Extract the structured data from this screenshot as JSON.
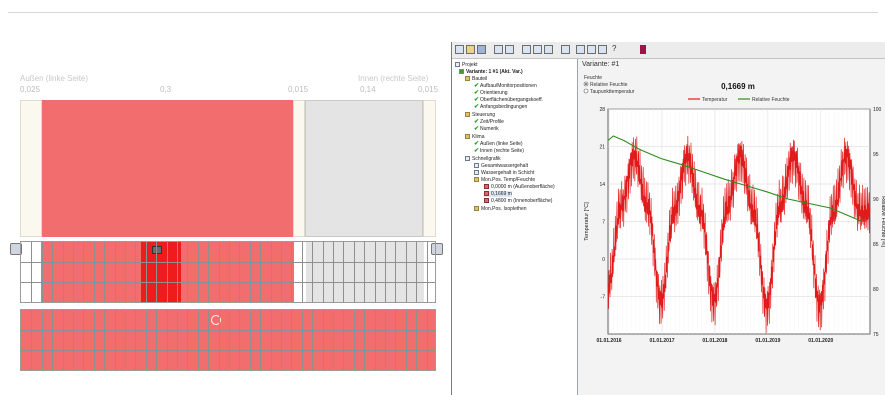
{
  "left": {
    "caption_left": "Außen (linke Seite)",
    "caption_right": "Innen (rechte Seite)",
    "thickness_ticks": [
      "0,025",
      "0,3",
      "0,015",
      "0,14",
      "0,015"
    ],
    "colors": {
      "brick": "#f26d6d",
      "brick_highlight": "#ee1c1c",
      "plaster": "#fbf8ef",
      "insulation": "#e4e4e4"
    }
  },
  "app": {
    "variant_label": "Variante:  #1",
    "tree": [
      "Projekt",
      "Variante: 1 #1 (Akt. Var.)",
      "Bauteil",
      "Aufbau/Monitorpositionen",
      "Orientierung",
      "Oberflächenübergangskoeff.",
      "Anfangsbedingungen",
      "Steuerung",
      "Zeit/Profile",
      "Numerik",
      "Klima",
      "Außen (linke Seite)",
      "Innen (rechte Seite)",
      "Schnellgrafik",
      "Gesamtwassergehalt",
      "Wassergehalt in Schicht",
      "Mon.Pos. Temp/Feuchte",
      "0,0000 m (Außenoberfläche)",
      "0,1669 m",
      "0,4800 m (Innenoberfläche)",
      "Mon.Pos. Isoplethen"
    ],
    "chart_options": [
      "Feuchte",
      "Relative Feuchte",
      "Taupunkttemperatur"
    ]
  },
  "chart_data": {
    "type": "line",
    "title": "0,1669 m",
    "xlabel": "",
    "ylabel": "Temperatur [°C]",
    "y2label": "Relative Feuchte [%]",
    "x_ticks": [
      "01.01.2016",
      "01.01.2017",
      "01.01.2018",
      "01.01.2019",
      "01.01.2020"
    ],
    "y_ticks": [
      "28",
      "21",
      "14",
      "7",
      "0",
      "-7"
    ],
    "y2_ticks": [
      "100",
      "95",
      "90",
      "85",
      "80",
      "75"
    ],
    "ylim": [
      -14,
      28
    ],
    "y2lim": [
      75,
      100
    ],
    "grid": true,
    "legend_position": "top",
    "series": [
      {
        "name": "Temperatur",
        "color": "#e11b1b",
        "axis": "left",
        "x": [
          2016.0,
          2016.25,
          2016.5,
          2016.75,
          2017.0,
          2017.25,
          2017.5,
          2017.75,
          2018.0,
          2018.25,
          2018.5,
          2018.75,
          2019.0,
          2019.25,
          2019.5,
          2019.75,
          2020.0,
          2020.25,
          2020.5,
          2020.75
        ],
        "values": [
          -5,
          10,
          19,
          10,
          -8,
          9,
          19,
          9,
          -8,
          10,
          19,
          9,
          -9,
          10,
          19,
          10,
          -9,
          9,
          19,
          9
        ],
        "noise": 5
      },
      {
        "name": "Relative Feuchte",
        "color": "#2e8b1e",
        "axis": "right",
        "x": [
          2016.0,
          2016.1,
          2016.3,
          2016.6,
          2017.0,
          2017.4,
          2017.8,
          2018.2,
          2018.6,
          2019.0,
          2019.4,
          2019.8,
          2020.2,
          2020.6,
          2020.8
        ],
        "values": [
          96.5,
          97.0,
          96.5,
          95.5,
          94.5,
          93.8,
          93.0,
          92.2,
          91.5,
          90.8,
          90.0,
          89.5,
          89.0,
          88.0,
          87.5
        ]
      }
    ]
  }
}
